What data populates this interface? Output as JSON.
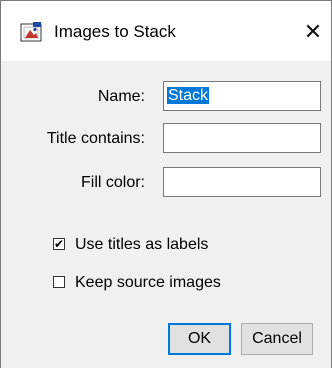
{
  "window": {
    "title": "Images to Stack",
    "close_glyph": "✕",
    "icon": "imagej-app-icon"
  },
  "form": {
    "name_label": "Name:",
    "name_value": "Stack",
    "title_contains_label": "Title contains:",
    "title_contains_value": "",
    "fill_color_label": "Fill color:",
    "fill_color_value": ""
  },
  "options": {
    "use_titles_label": "Use titles as labels",
    "use_titles_checked": true,
    "keep_source_label": "Keep source images",
    "keep_source_checked": false,
    "check_glyph": "✔"
  },
  "buttons": {
    "ok_label": "OK",
    "cancel_label": "Cancel"
  },
  "colors": {
    "selection": "#0078d7",
    "dialog_bg": "#f0f0f0",
    "button_bg": "#e1e1e1"
  }
}
